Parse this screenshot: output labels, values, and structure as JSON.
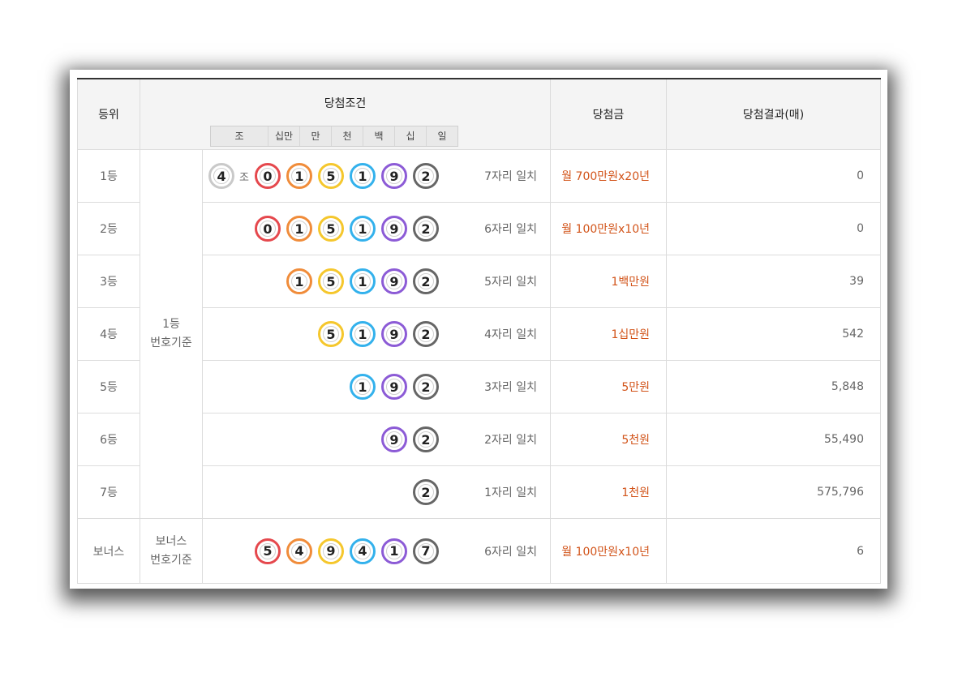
{
  "header": {
    "rank": "등위",
    "condition": "당첨조건",
    "prize": "당첨금",
    "result": "당첨결과(매)",
    "digit_labels": [
      "조",
      "십만",
      "만",
      "천",
      "백",
      "십",
      "일"
    ]
  },
  "basis": {
    "main": [
      "1등",
      "번호기준"
    ],
    "bonus": [
      "보너스",
      "번호기준"
    ]
  },
  "rows": [
    {
      "rank": "1등",
      "jo": "4",
      "jo_label": "조",
      "digits": [
        "0",
        "1",
        "5",
        "1",
        "9",
        "2"
      ],
      "match": "7자리 일치",
      "prize": "월 700만원x20년",
      "count": "0"
    },
    {
      "rank": "2등",
      "digits": [
        "0",
        "1",
        "5",
        "1",
        "9",
        "2"
      ],
      "match": "6자리 일치",
      "prize": "월 100만원x10년",
      "count": "0"
    },
    {
      "rank": "3등",
      "digits": [
        "1",
        "5",
        "1",
        "9",
        "2"
      ],
      "match": "5자리 일치",
      "prize": "1백만원",
      "count": "39"
    },
    {
      "rank": "4등",
      "digits": [
        "5",
        "1",
        "9",
        "2"
      ],
      "match": "4자리 일치",
      "prize": "1십만원",
      "count": "542"
    },
    {
      "rank": "5등",
      "digits": [
        "1",
        "9",
        "2"
      ],
      "match": "3자리 일치",
      "prize": "5만원",
      "count": "5,848"
    },
    {
      "rank": "6등",
      "digits": [
        "9",
        "2"
      ],
      "match": "2자리 일치",
      "prize": "5천원",
      "count": "55,490"
    },
    {
      "rank": "7등",
      "digits": [
        "2"
      ],
      "match": "1자리 일치",
      "prize": "1천원",
      "count": "575,796"
    }
  ],
  "bonus_row": {
    "rank": "보너스",
    "digits": [
      "5",
      "4",
      "9",
      "4",
      "1",
      "7"
    ],
    "match": "6자리 일치",
    "prize": "월 100만원x10년",
    "count": "6"
  },
  "colors": {
    "ball_sequence": [
      "#e5484d",
      "#f08c3a",
      "#f5c72d",
      "#33b1ec",
      "#8c5bd6",
      "#666666"
    ],
    "jo_ball": "#c9c9c9",
    "prize_text": "#d2541a"
  }
}
